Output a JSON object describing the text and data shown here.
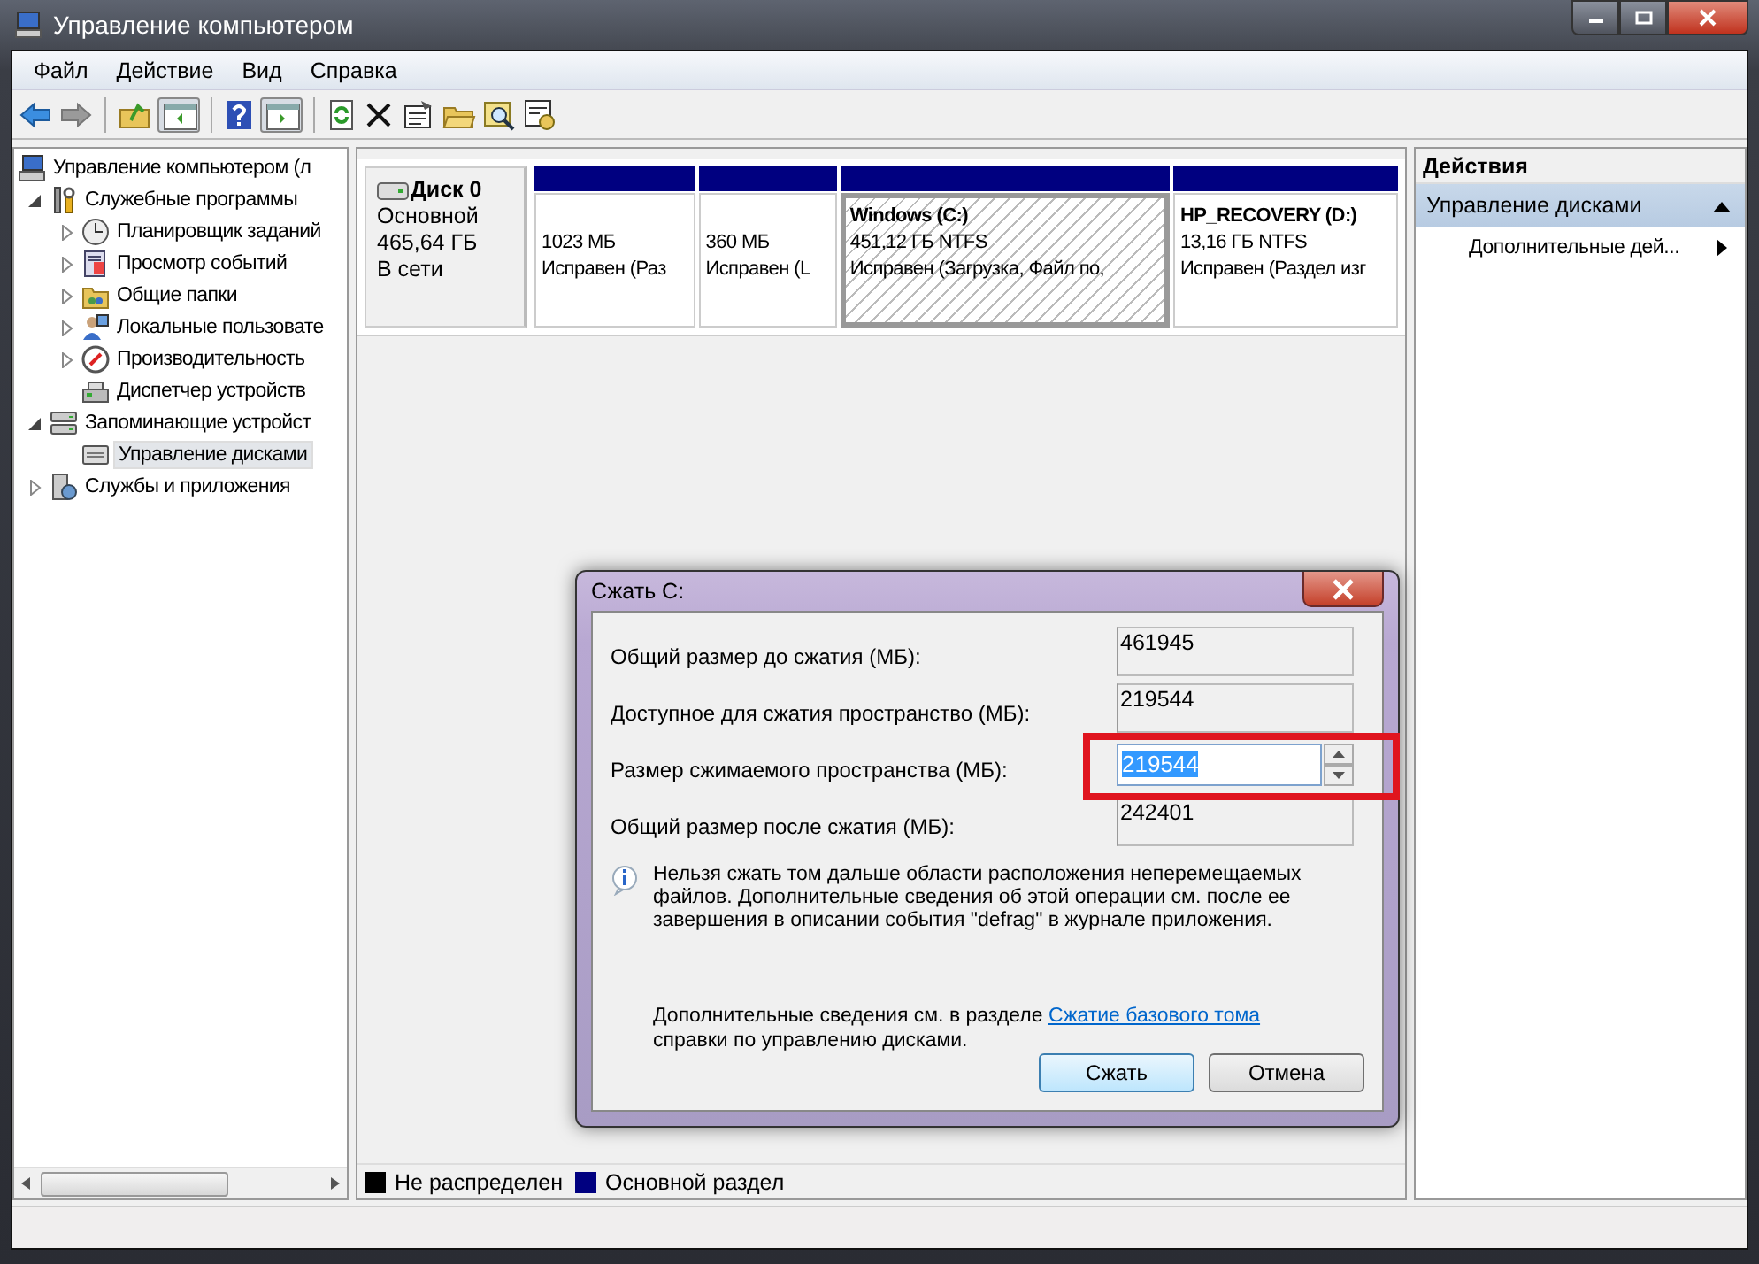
{
  "window": {
    "title": "Управление компьютером"
  },
  "menu": [
    "Файл",
    "Действие",
    "Вид",
    "Справка"
  ],
  "tree": [
    {
      "label": "Управление компьютером (л",
      "selected": false,
      "children": [
        {
          "label": "Служебные программы",
          "expanded": true,
          "selected": false,
          "children": [
            {
              "label": "Планировщик заданий",
              "expanded": false,
              "selected": false
            },
            {
              "label": "Просмотр событий",
              "expanded": false,
              "selected": false
            },
            {
              "label": "Общие папки",
              "expanded": false,
              "selected": false
            },
            {
              "label": "Локальные пользовате",
              "expanded": false,
              "selected": false
            },
            {
              "label": "Производительность",
              "expanded": false,
              "selected": false
            },
            {
              "label": "Диспетчер устройств",
              "selected": false
            }
          ]
        },
        {
          "label": "Запоминающие устройст",
          "expanded": true,
          "selected": false,
          "children": [
            {
              "label": "Управление дисками",
              "selected": true
            }
          ]
        },
        {
          "label": "Службы и приложения",
          "expanded": false,
          "selected": false
        }
      ]
    }
  ],
  "disk": {
    "name": "Диск 0",
    "type": "Основной",
    "size": "465,64 ГБ",
    "status": "В сети",
    "partitions": [
      {
        "size": "1023 МБ",
        "health": "Исправен (Раз",
        "selected": false
      },
      {
        "size": "360 МБ",
        "health": "Исправен (L",
        "selected": false
      },
      {
        "title": "Windows  (C:)",
        "size": "451,12 ГБ NTFS",
        "health": "Исправен (Загрузка, Файл по,",
        "selected": true
      },
      {
        "title": "HP_RECOVERY  (D:)",
        "size": "13,16 ГБ NTFS",
        "health": "Исправен (Раздел изг",
        "selected": false
      }
    ]
  },
  "legend": [
    {
      "label": "Не распределен",
      "color": "#000000"
    },
    {
      "label": "Основной раздел",
      "color": "#000080"
    }
  ],
  "actions": {
    "title": "Действия",
    "section": "Управление дисками",
    "items": [
      "Дополнительные дей..."
    ]
  },
  "dialog": {
    "title": "Сжать C:",
    "fields": [
      {
        "label": "Общий размер до сжатия (МБ):",
        "value": "461945",
        "kind": "readonly"
      },
      {
        "label": "Доступное для сжатия пространство (МБ):",
        "value": "219544",
        "kind": "readonly"
      },
      {
        "label": "Размер сжимаемого пространства (МБ):",
        "value": "219544",
        "kind": "spin",
        "highlighted": true
      },
      {
        "label": "Общий размер после сжатия (МБ):",
        "value": "242401",
        "kind": "readonly"
      }
    ],
    "info": "Нельзя сжать том дальше области расположения неперемещаемых файлов. Дополнительные сведения об этой операции см. после ее завершения в описании события \"defrag\" в журнале приложения.",
    "help_before": "Дополнительные сведения см. в разделе ",
    "help_link": "Сжатие базового тома",
    "help_after": " справки по управлению дисками.",
    "buttons": [
      {
        "label": "Сжать",
        "default": true
      },
      {
        "label": "Отмена",
        "default": false
      }
    ]
  }
}
